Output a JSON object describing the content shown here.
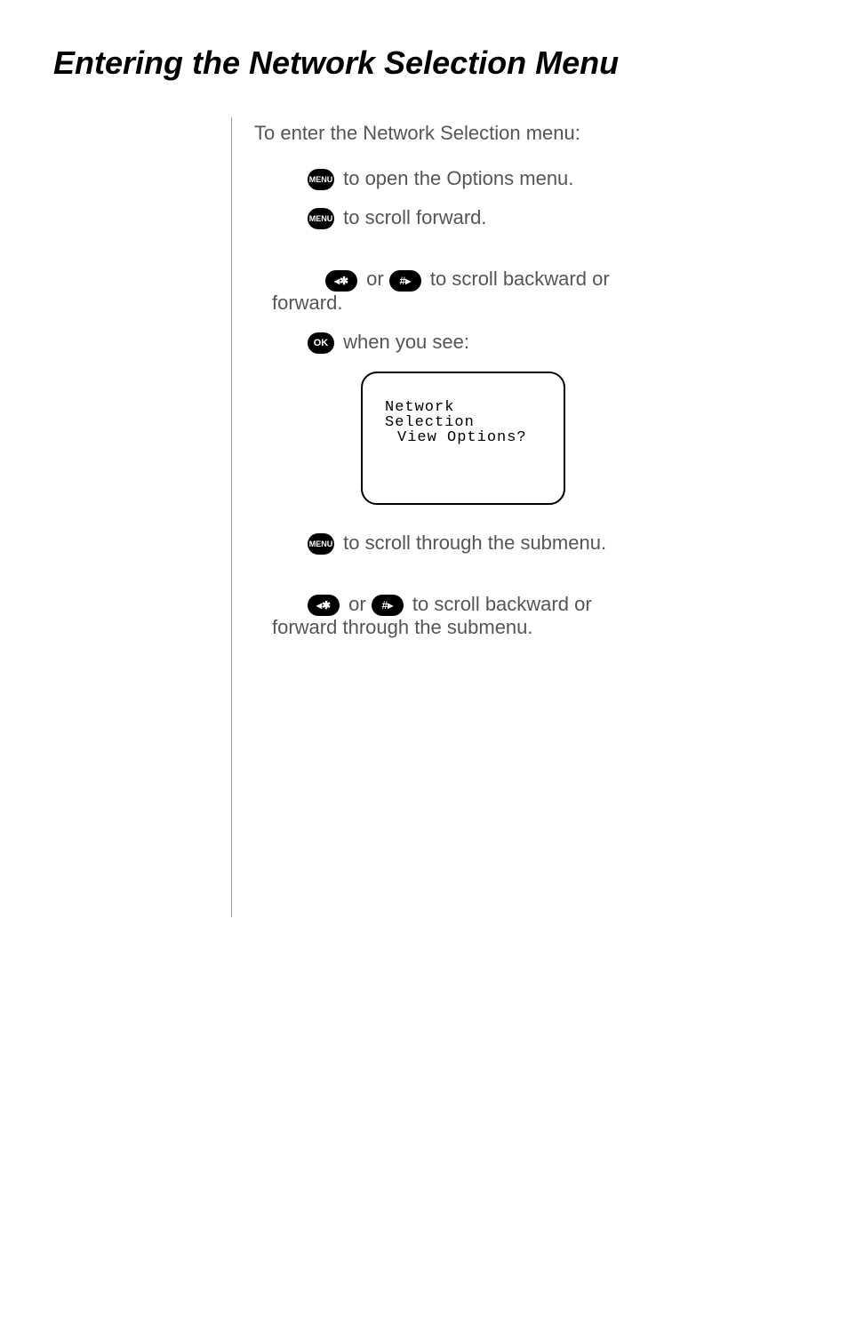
{
  "title": "Entering the Network Selection Menu",
  "intro": "To enter the Network Selection menu:",
  "icons": {
    "menu": "MENU",
    "left": "◂✱",
    "right": "#▸",
    "ok": "OK"
  },
  "steps": {
    "s1": " to open the Options menu.",
    "s2": " to scroll forward.",
    "s3_mid": " or ",
    "s3_end": " to scroll backward or",
    "s3_wrap": "forward.",
    "s4": " when you see:",
    "s5": " to scroll through the submenu.",
    "s6_mid": " or ",
    "s6_end": " to scroll backward or",
    "s6_wrap": "forward through the submenu."
  },
  "screen": {
    "line1": "Network",
    "line2": "Selection",
    "line3": "View Options?"
  }
}
